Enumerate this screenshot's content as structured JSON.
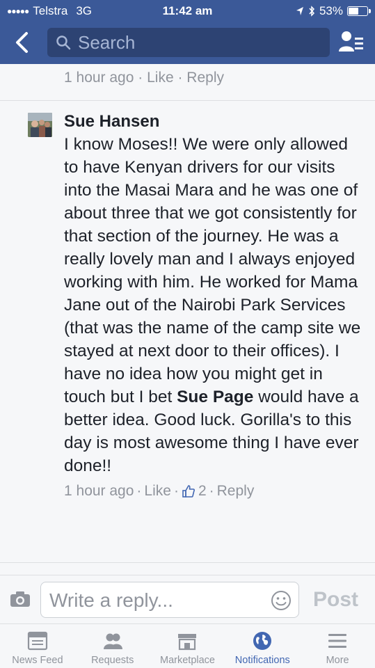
{
  "status_bar": {
    "carrier": "Telstra",
    "network": "3G",
    "time": "11:42 am",
    "battery_percent": "53%",
    "battery_level": 0.53
  },
  "header": {
    "search_placeholder": "Search"
  },
  "previous_comment": {
    "meta": {
      "time": "1 hour ago",
      "like": "Like",
      "reply": "Reply"
    }
  },
  "comment": {
    "author": "Sue Hansen",
    "text_before_mention": "I know Moses!!  We were only allowed to have Kenyan drivers for our visits into the Masai Mara and he was one of about three that we got consistently for that section of the journey.  He was a really lovely man and I always enjoyed working with him.  He worked for Mama Jane out of the Nairobi Park Services (that was the name of the camp site we stayed at next door to their offices).  I have no idea how you might get in touch but I bet ",
    "mention": "Sue Page",
    "text_after_mention": " would have a better idea.  Good luck.  Gorilla's to this day is most awesome thing I have ever done!!",
    "meta": {
      "time": "1 hour ago",
      "like": "Like",
      "like_count": "2",
      "reply": "Reply"
    }
  },
  "reply_bar": {
    "placeholder": "Write a reply...",
    "post_label": "Post"
  },
  "tabs": [
    {
      "label": "News Feed",
      "icon": "news-feed-icon",
      "active": false
    },
    {
      "label": "Requests",
      "icon": "friend-requests-icon",
      "active": false
    },
    {
      "label": "Marketplace",
      "icon": "marketplace-icon",
      "active": false
    },
    {
      "label": "Notifications",
      "icon": "globe-icon",
      "active": true
    },
    {
      "label": "More",
      "icon": "menu-icon",
      "active": false
    }
  ],
  "colors": {
    "brand_blue": "#3b5998",
    "active_tab": "#4267b2",
    "meta_gray": "#90949c"
  }
}
